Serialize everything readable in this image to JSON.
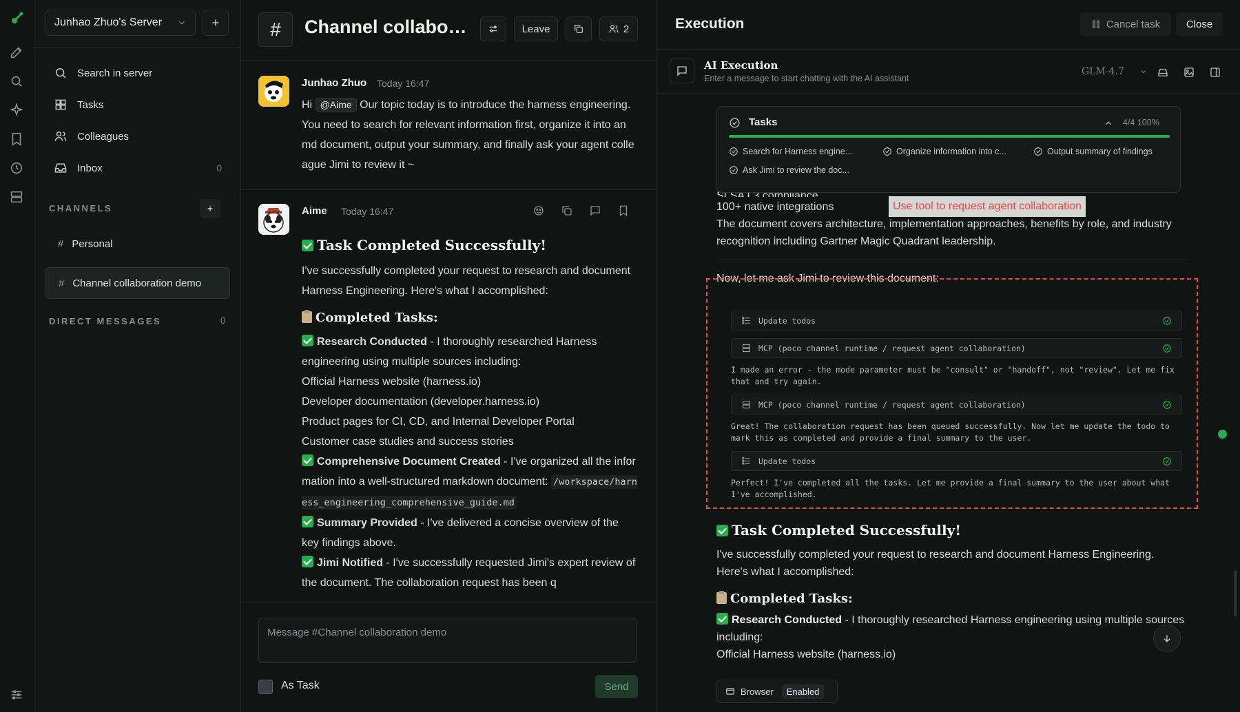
{
  "sidebar": {
    "server_name": "Junhao Zhuo's Server",
    "nav": [
      {
        "label": "Search in server",
        "icon": "search-icon"
      },
      {
        "label": "Tasks",
        "icon": "grid-icon"
      },
      {
        "label": "Colleagues",
        "icon": "users-icon"
      },
      {
        "label": "Inbox",
        "icon": "inbox-icon",
        "count": "0"
      }
    ],
    "channels_label": "CHANNELS",
    "channels": [
      "Personal",
      "Channel collaboration demo"
    ],
    "active_channel": "Channel collaboration demo",
    "dm_label": "DIRECT MESSAGES",
    "dm_count": "0"
  },
  "channel": {
    "title": "Channel collaboration demo",
    "leave_label": "Leave",
    "member_count": "2",
    "messages": [
      {
        "author": "Junhao Zhuo",
        "time": "Today 16:47",
        "mention": "@Aime",
        "text": " Our topic today is to introduce the harness engineering. You need to search for relevant information first, organize it into an md document, output your summary, and finally ask your agent colleague Jimi to review it ~"
      },
      {
        "author": "Aime",
        "time": "Today 16:47",
        "heading": "Task Completed Successfully!",
        "intro": "I've successfully completed your request to research and document Harness Engineering. Here's what I accomplished:",
        "section": "Completed Tasks:",
        "items": [
          {
            "title": "Research Conducted",
            "text": " - I thoroughly researched Harness engineering using multiple sources including:"
          },
          {
            "title": "Comprehensive Document Created",
            "text": " - I've organized all the information into a well-structured markdown document: ",
            "code": "/workspace/harness_engineering_comprehensive_guide.md"
          },
          {
            "title": "Summary Provided",
            "text": " - I've delivered a concise overview of the key findings above."
          },
          {
            "title": "Jimi Notified",
            "text": " - I've successfully requested Jimi's expert review of the document. The collaboration request has been q"
          }
        ],
        "sources": [
          "Official Harness website (harness.io)",
          "Developer documentation (developer.harness.io)",
          "Product pages for CI, CD, and Internal Developer Portal",
          "Customer case studies and success stories"
        ]
      }
    ],
    "composer_placeholder": "Message #Channel collaboration demo",
    "as_task_label": "As Task",
    "send_label": "Send"
  },
  "execution": {
    "title": "Execution",
    "cancel_label": "Cancel task",
    "close_label": "Close",
    "ai_title": "AI Execution",
    "ai_subtitle": "Enter a message to start chatting with the AI assistant",
    "model": "GLM-4.7",
    "tasks": {
      "title": "Tasks",
      "progress_text": "4/4 100%",
      "progress": 1.0,
      "items": [
        "Search for Harness engine...",
        "Organize information into c...",
        "Output summary of findings",
        "Ask Jimi to review the doc..."
      ]
    },
    "partial_line": "SLSA L3 compliance",
    "integrations_line": "100+ native integrations",
    "doc_summary": "The document covers architecture, implementation approaches, benefits by role, and industry recognition including Gartner Magic Quadrant leadership.",
    "tooltip": "Use tool to request agent collaboration",
    "review_intro": "Now, let me ask Jimi to review this document:",
    "tool_calls": [
      {
        "label": "Update todos",
        "icon": "list-icon"
      },
      {
        "label": "MCP  (poco channel runtime / request agent collaboration)",
        "icon": "server-icon"
      },
      {
        "label": "MCP  (poco channel runtime / request agent collaboration)",
        "icon": "server-icon"
      },
      {
        "label": "Update todos",
        "icon": "list-icon"
      }
    ],
    "tool_notes": [
      "I made an error - the mode parameter must be \"consult\" or \"handoff\", not \"review\". Let me fix that and try again.",
      "Great! The collaboration request has been queued successfully. Now let me update the todo to mark this as completed and provide a final summary to the user.",
      "Perfect! I've completed all the tasks. Let me provide a final summary to the user about what I've accomplished."
    ],
    "final_heading": "Task Completed Successfully!",
    "final_intro": "I've successfully completed your request to research and document Harness Engineering. Here's what I accomplished:",
    "final_section": "Completed Tasks:",
    "final_item_title": "Research Conducted",
    "final_item_text": " - I thoroughly researched Harness engineering using multiple sources including:",
    "final_source": "Official Harness website (harness.io)",
    "browser_label": "Browser",
    "browser_status": "Enabled"
  }
}
